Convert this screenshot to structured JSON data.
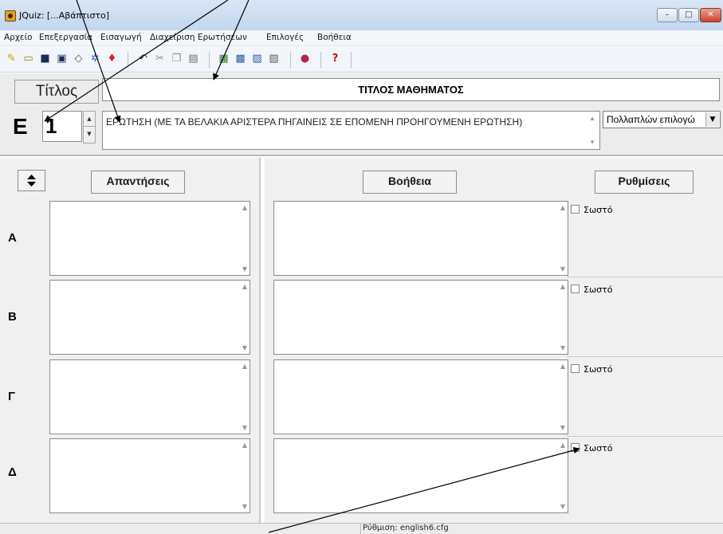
{
  "window": {
    "title": "JQuiz: [...Αβάπτιστο]",
    "minimize_glyph": "–",
    "maximize_glyph": "□",
    "close_glyph": "✕"
  },
  "menu": [
    "Αρχείο",
    "Επεξεργασία",
    "Εισαγωγή",
    "Διαχείριση Ερωτήσεων",
    "Επιλογές",
    "Βοήθεια"
  ],
  "toolbar": {
    "icons": [
      "new-file-icon",
      "open-folder-icon",
      "save-icon",
      "save-as-icon",
      "eraser-icon",
      "web-export-icon",
      "red-arrow-icon",
      "undo-icon",
      "cut-icon",
      "copy-icon",
      "paste-icon",
      "config-icon",
      "add-picture-icon",
      "insert-link-icon",
      "keypad-icon",
      "hotpotatoes-icon",
      "help-icon"
    ]
  },
  "header": {
    "title_button": "Τίτλος",
    "title_value": "ΤΙΤΛΟΣ ΜΑΘΗΜΑΤΟΣ",
    "question_label": "Ε",
    "question_number": "1",
    "question_text": "ΕΡΩΤΗΣΗ (ΜΕ ΤΑ ΒΕΛΑΚΙΑ ΑΡΙΣΤΕΡΑ ΠΗΓΑΙΝΕΙΣ ΣΕ ΕΠΟΜΕΝΗ ΠΡΟΗΓΟΥΜΕΝΗ ΕΡΩΤΗΣΗ)",
    "question_type": "Πολλαπλών επιλογώ"
  },
  "columns": {
    "answers": "Απαντήσεις",
    "help": "Βοήθεια",
    "settings": "Ρυθμίσεις"
  },
  "rows": [
    {
      "letter": "Α",
      "answer": "",
      "feedback": "",
      "correct_label": "Σωστό",
      "correct": false
    },
    {
      "letter": "Β",
      "answer": "",
      "feedback": "",
      "correct_label": "Σωστό",
      "correct": false
    },
    {
      "letter": "Γ",
      "answer": "",
      "feedback": "",
      "correct_label": "Σωστό",
      "correct": false
    },
    {
      "letter": "Δ",
      "answer": "",
      "feedback": "",
      "correct_label": "Σωστό",
      "correct": false
    }
  ],
  "status": "Ρύθμιση: english6.cfg",
  "colors": {
    "titlebar": "#c3d6ee",
    "close_button": "#c9452f",
    "panel_bg": "#f0f0f0"
  }
}
